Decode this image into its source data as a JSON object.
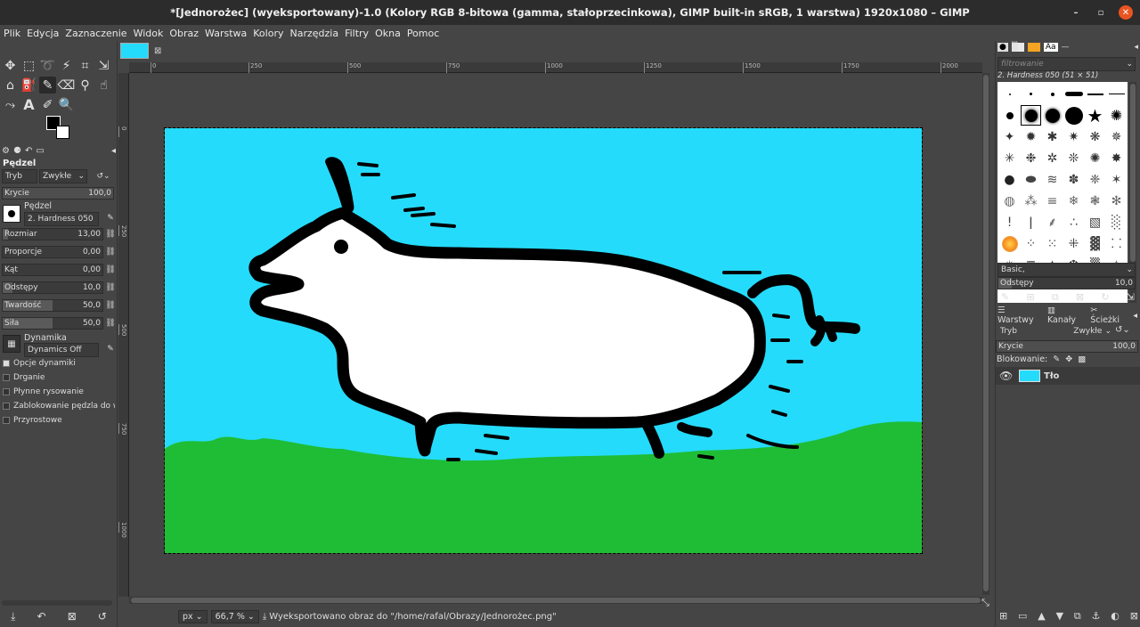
{
  "window": {
    "title": "*[Jednorożec] (wyeksportowany)-1.0 (Kolory RGB 8-bitowa (gamma, stałoprzecinkowa), GIMP built-in sRGB, 1 warstwa) 1920x1080 – GIMP",
    "minimize_label": "–",
    "maximize_label": "▫",
    "close_label": "✕"
  },
  "menu": [
    "Plik",
    "Edycja",
    "Zaznaczenie",
    "Widok",
    "Obraz",
    "Warstwa",
    "Kolory",
    "Narzędzia",
    "Filtry",
    "Okna",
    "Pomoc"
  ],
  "tool_options": {
    "title": "Pędzel",
    "mode_label": "Tryb",
    "mode_value": "Zwykłe",
    "opacity_label": "Krycie",
    "opacity_value": "100,0",
    "brush_label": "Pędzel",
    "brush_value": "2. Hardness 050",
    "size_label": "Rozmiar",
    "size_value": "13,00",
    "ratio_label": "Proporcje",
    "ratio_value": "0,00",
    "angle_label": "Kąt",
    "angle_value": "0,00",
    "spacing_label": "Odstępy",
    "spacing_value": "10,0",
    "hardness_label": "Twardość",
    "hardness_value": "50,0",
    "force_label": "Siła",
    "force_value": "50,0",
    "dynamics_label": "Dynamika",
    "dynamics_value": "Dynamics Off",
    "checks": [
      {
        "label": "Opcje dynamiki",
        "checked": true
      },
      {
        "label": "Drganie",
        "checked": false
      },
      {
        "label": "Płynne rysowanie",
        "checked": false
      },
      {
        "label": "Zablokowanie pędzla do widoku",
        "checked": false
      },
      {
        "label": "Przyrostowe",
        "checked": false
      }
    ]
  },
  "rulers": {
    "top": [
      "0",
      "250",
      "500",
      "750",
      "1000",
      "1250",
      "1500",
      "1750",
      "2000"
    ],
    "left": [
      "0",
      "250",
      "500",
      "750",
      "1000"
    ]
  },
  "status": {
    "unit": "px",
    "zoom": "66,7 %",
    "message": "Wyeksportowano obraz do \"/home/rafal/Obrazy/Jednorożec.png\""
  },
  "brushes_panel": {
    "filter_placeholder": "filtrowanie",
    "selected_brush": "2. Hardness 050 (51 × 51)",
    "preset": "Basic,",
    "spacing_label": "Odstępy",
    "spacing_value": "10,0"
  },
  "layers_panel": {
    "tabs": [
      "Warstwy",
      "Kanały",
      "Ścieżki"
    ],
    "mode_label": "Tryb",
    "mode_value": "Zwykłe",
    "opacity_label": "Krycie",
    "opacity_value": "100,0",
    "lock_label": "Blokowanie:",
    "layer_name": "Tło"
  },
  "colors": {
    "sky": "#25dbfb",
    "grass": "#1fbd35",
    "accent": "#e95420"
  }
}
